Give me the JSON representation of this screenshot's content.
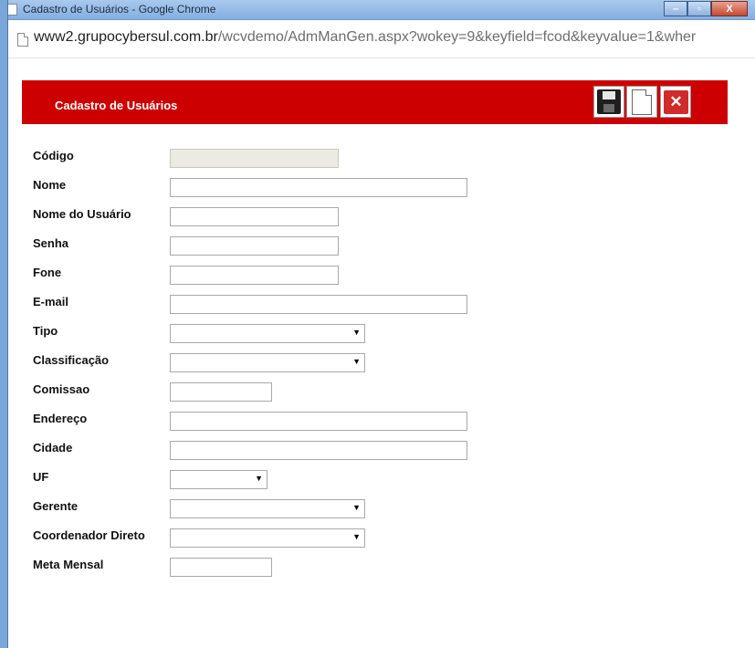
{
  "window": {
    "title": "Cadastro de Usuários - Google Chrome",
    "minimize": "–",
    "maximize": "▫",
    "close": "X"
  },
  "address": {
    "host": "www2.grupocybersul.com.br",
    "path": "/wcvdemo/AdmManGen.aspx?wokey=9&keyfield=fcod&keyvalue=1&wher"
  },
  "header": {
    "title": "Cadastro de Usuários",
    "close_glyph": "✕"
  },
  "form": {
    "codigo": {
      "label": "Código",
      "value": ""
    },
    "nome": {
      "label": "Nome",
      "value": ""
    },
    "nome_usuario": {
      "label": "Nome do Usuário",
      "value": ""
    },
    "senha": {
      "label": "Senha",
      "value": ""
    },
    "fone": {
      "label": "Fone",
      "value": ""
    },
    "email": {
      "label": "E-mail",
      "value": ""
    },
    "tipo": {
      "label": "Tipo",
      "selected": ""
    },
    "classificacao": {
      "label": "Classificação",
      "selected": ""
    },
    "comissao": {
      "label": "Comissao",
      "value": ""
    },
    "endereco": {
      "label": "Endereço",
      "value": ""
    },
    "cidade": {
      "label": "Cidade",
      "value": ""
    },
    "uf": {
      "label": "UF",
      "selected": ""
    },
    "gerente": {
      "label": "Gerente",
      "selected": ""
    },
    "coordenador": {
      "label": "Coordenador Direto",
      "selected": ""
    },
    "meta": {
      "label": "Meta Mensal",
      "value": ""
    }
  },
  "icons": {
    "save": "floppy-disk-icon",
    "new": "new-document-icon",
    "close": "close-icon"
  },
  "colors": {
    "header_bg": "#cc0000",
    "titlebar": "#84afe0"
  }
}
